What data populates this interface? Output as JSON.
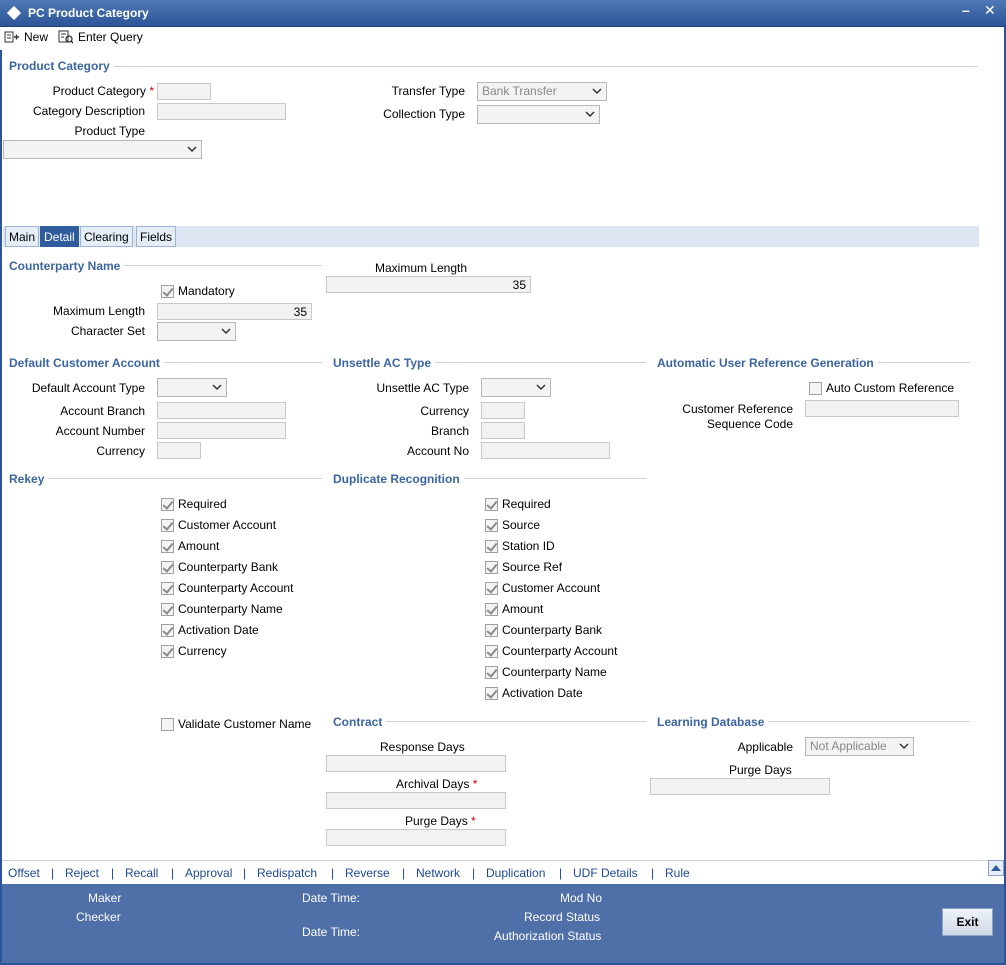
{
  "window": {
    "title": "PC Product Category",
    "minimize": "–",
    "close": "✕"
  },
  "toolbar": {
    "new_label": "New",
    "enter_query_label": "Enter Query"
  },
  "product_category": {
    "section": "Product Category",
    "category_label": "Product Category",
    "category_value": "",
    "description_label": "Category Description",
    "description_value": "",
    "product_type_label": "Product Type",
    "product_type_value": "",
    "transfer_type_label": "Transfer Type",
    "transfer_type_value": "Bank Transfer",
    "collection_type_label": "Collection Type",
    "collection_type_value": ""
  },
  "tabs": [
    {
      "label": "Main"
    },
    {
      "label": "Detail"
    },
    {
      "label": "Clearing"
    },
    {
      "label": "Fields"
    }
  ],
  "counterparty": {
    "section": "Counterparty Name",
    "mandatory_label": "Mandatory",
    "max_length_label": "Maximum Length",
    "max_length_value": "35",
    "charset_label": "Character Set",
    "charset_value": "",
    "right_max_length_label": "Maximum Length",
    "right_max_length_value": "35"
  },
  "default_customer_account": {
    "section": "Default Customer Account",
    "account_type_label": "Default Account Type",
    "branch_label": "Account Branch",
    "number_label": "Account Number",
    "currency_label": "Currency"
  },
  "unsettle_ac": {
    "section": "Unsettle AC Type",
    "type_label": "Unsettle AC Type",
    "currency_label": "Currency",
    "branch_label": "Branch",
    "account_no_label": "Account No"
  },
  "auto_ref": {
    "section": "Automatic User Reference Generation",
    "auto_custom_label": "Auto Custom Reference",
    "seq_code_label_1": "Customer Reference",
    "seq_code_label_2": "Sequence Code"
  },
  "rekey": {
    "section": "Rekey",
    "items": [
      "Required",
      "Customer Account",
      "Amount",
      "Counterparty Bank",
      "Counterparty Account",
      "Counterparty Name",
      "Activation Date",
      "Currency"
    ]
  },
  "duplicate": {
    "section": "Duplicate Recognition",
    "items": [
      "Required",
      "Source",
      "Station ID",
      "Source Ref",
      "Customer Account",
      "Amount",
      "Counterparty Bank",
      "Counterparty Account",
      "Counterparty Name",
      "Activation Date"
    ]
  },
  "validate_customer_name_label": "Validate Customer Name",
  "contract": {
    "section": "Contract",
    "response_days_label": "Response Days",
    "archival_days_label": "Archival Days",
    "purge_days_label": "Purge Days"
  },
  "learning_db": {
    "section": "Learning Database",
    "applicable_label": "Applicable",
    "applicable_value": "Not Applicable",
    "purge_days_label": "Purge Days"
  },
  "links": [
    "Offset",
    "Reject",
    "Recall",
    "Approval",
    "Redispatch",
    "Reverse",
    "Network",
    "Duplication",
    "UDF Details",
    "Rule"
  ],
  "footer": {
    "maker_label": "Maker",
    "checker_label": "Checker",
    "date_time_label": "Date Time:",
    "mod_no_label": "Mod No",
    "record_status_label": "Record Status",
    "auth_status_label": "Authorization Status",
    "exit_label": "Exit"
  }
}
